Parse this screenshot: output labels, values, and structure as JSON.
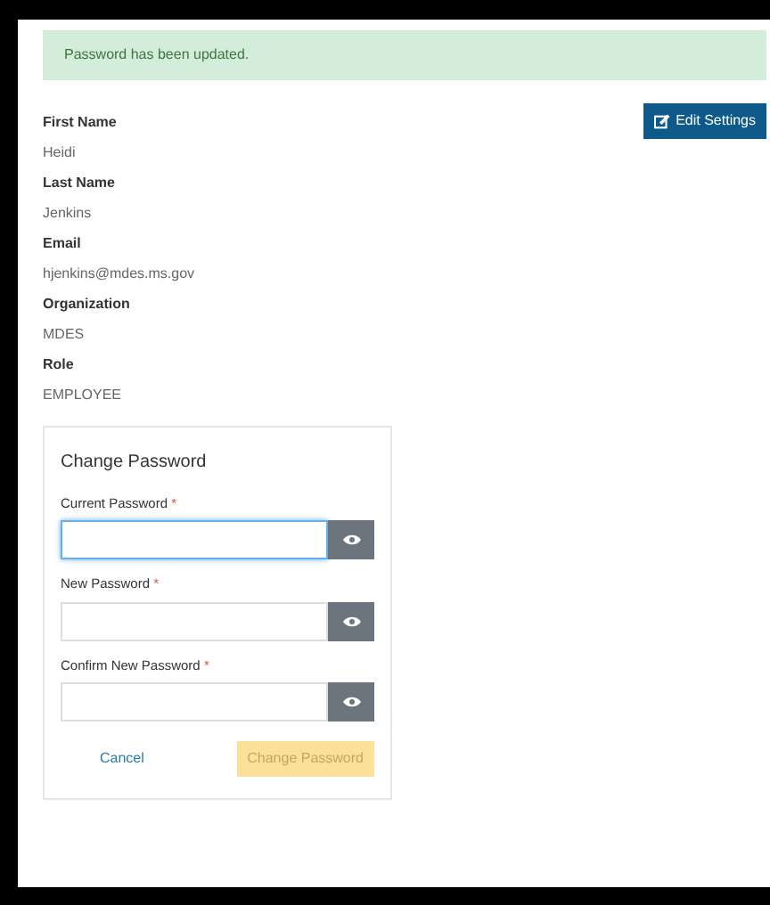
{
  "alert": {
    "message": "Password has been updated."
  },
  "edit_button": {
    "label": "Edit Settings"
  },
  "profile": [
    {
      "label": "First Name",
      "value": "Heidi"
    },
    {
      "label": "Last Name",
      "value": "Jenkins"
    },
    {
      "label": "Email",
      "value": "hjenkins@mdes.ms.gov"
    },
    {
      "label": "Organization",
      "value": "MDES"
    },
    {
      "label": "Role",
      "value": "EMPLOYEE"
    }
  ],
  "change_password": {
    "title": "Change Password",
    "fields": [
      {
        "label": "Current Password",
        "required_mark": "*",
        "focused": true
      },
      {
        "label": "New Password",
        "required_mark": "*",
        "focused": false
      },
      {
        "label": "Confirm New Password",
        "required_mark": "*",
        "focused": false
      }
    ],
    "cancel": "Cancel",
    "submit": {
      "label": "Change Password",
      "disabled": true
    }
  }
}
